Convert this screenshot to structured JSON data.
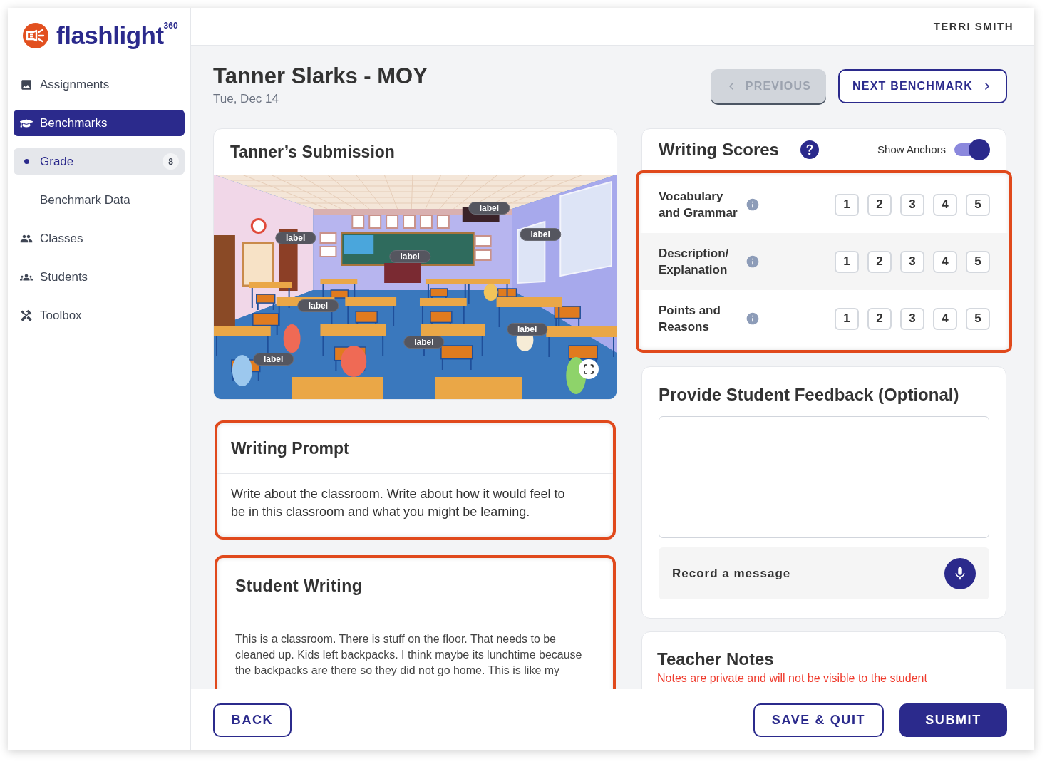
{
  "sidebar": {
    "logo": {
      "name": "flashlight",
      "superscript": "360"
    },
    "items": [
      {
        "label": "Assignments",
        "selected": false
      },
      {
        "label": "Benchmarks",
        "selected": true,
        "children": [
          {
            "label": "Grade",
            "selected": true,
            "badge": "8"
          },
          {
            "label": "Benchmark Data",
            "selected": false
          }
        ]
      },
      {
        "label": "Classes",
        "selected": false
      },
      {
        "label": "Students",
        "selected": false
      },
      {
        "label": "Toolbox",
        "selected": false
      }
    ]
  },
  "header": {
    "user_name": "TERRI SMITH"
  },
  "page": {
    "title": "Tanner Slarks - MOY",
    "date": "Tue, Dec 14"
  },
  "nav_buttons": [
    {
      "label": "PREVIOUS",
      "kind": "previous",
      "disabled": true
    },
    {
      "label": "NEXT BENCHMARK",
      "kind": "next",
      "disabled": false
    }
  ],
  "submission": {
    "title": "Tanner’s Submission",
    "hotspots": [
      {
        "label": "label"
      },
      {
        "label": "label"
      },
      {
        "label": "label"
      },
      {
        "label": "label"
      },
      {
        "label": "label"
      },
      {
        "label": "label"
      },
      {
        "label": "label"
      },
      {
        "label": "label"
      }
    ]
  },
  "writing_prompt": {
    "title": "Writing Prompt",
    "highlighted": true,
    "text": "Write about the classroom. Write about how it would feel to be in this classroom and what you might be learning."
  },
  "student_writing": {
    "title": "Student Writing",
    "highlighted": true,
    "text": "This is a classroom. There is stuff on the floor. That needs to be cleaned up. Kids left backpacks. I think maybe its lunchtime because the backpacks are there so they did not go home. This is like my"
  },
  "writing_scores": {
    "title": "Writing Scores",
    "show_anchors": {
      "label": "Show Anchors",
      "on": true
    },
    "highlighted": true,
    "criteria": [
      {
        "label": "Vocabulary and Grammar",
        "options": [
          {
            "label": "1",
            "selected": false
          },
          {
            "label": "2",
            "selected": false
          },
          {
            "label": "3",
            "selected": false
          },
          {
            "label": "4",
            "selected": false
          },
          {
            "label": "5",
            "selected": false
          }
        ]
      },
      {
        "label": "Description/ Explanation",
        "options": [
          {
            "label": "1",
            "selected": false
          },
          {
            "label": "2",
            "selected": false
          },
          {
            "label": "3",
            "selected": false
          },
          {
            "label": "4",
            "selected": false
          },
          {
            "label": "5",
            "selected": false
          }
        ]
      },
      {
        "label": "Points and Reasons",
        "options": [
          {
            "label": "1",
            "selected": false
          },
          {
            "label": "2",
            "selected": false
          },
          {
            "label": "3",
            "selected": false
          },
          {
            "label": "4",
            "selected": false
          },
          {
            "label": "5",
            "selected": false
          }
        ]
      }
    ]
  },
  "feedback": {
    "title": "Provide Student Feedback (Optional)",
    "record_label": "Record a message"
  },
  "teacher_notes": {
    "title": "Teacher Notes",
    "note": "Notes are private and will not be visible to the student"
  },
  "footer": {
    "left": [
      {
        "label": "BACK",
        "kind": "outline"
      }
    ],
    "right": [
      {
        "label": "SAVE & QUIT",
        "kind": "outline"
      },
      {
        "label": "SUBMIT",
        "kind": "primary"
      }
    ]
  }
}
